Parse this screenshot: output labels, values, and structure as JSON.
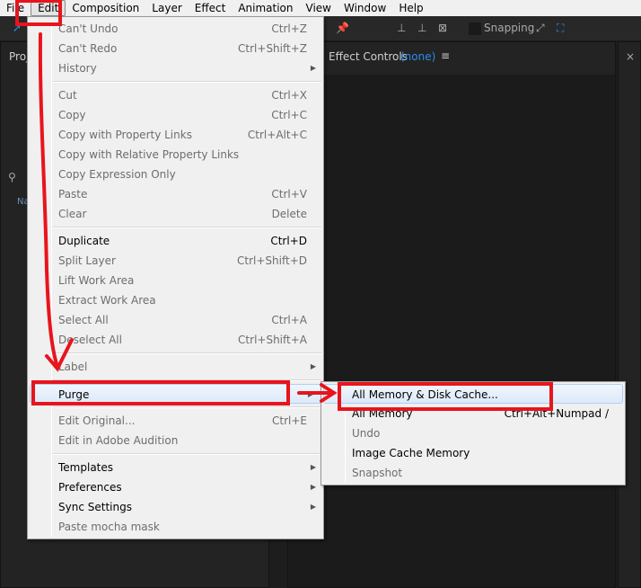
{
  "menubar": [
    "File",
    "Edit",
    "Composition",
    "Layer",
    "Effect",
    "Animation",
    "View",
    "Window",
    "Help"
  ],
  "toolbar": {
    "snapping": "Snapping"
  },
  "panels": {
    "project": "Proj",
    "effect_controls": "Effect Controls",
    "effect_controls_target": "(none)",
    "name_col": "Na",
    "close": "×"
  },
  "edit_menu": [
    {
      "label": "Can't Undo",
      "shortcut": "Ctrl+Z",
      "enabled": false
    },
    {
      "label": "Can't Redo",
      "shortcut": "Ctrl+Shift+Z",
      "enabled": false
    },
    {
      "label": "History",
      "shortcut": "",
      "enabled": false,
      "submenu": true
    },
    {
      "sep": true
    },
    {
      "label": "Cut",
      "shortcut": "Ctrl+X",
      "enabled": false
    },
    {
      "label": "Copy",
      "shortcut": "Ctrl+C",
      "enabled": false
    },
    {
      "label": "Copy with Property Links",
      "shortcut": "Ctrl+Alt+C",
      "enabled": false
    },
    {
      "label": "Copy with Relative Property Links",
      "shortcut": "",
      "enabled": false
    },
    {
      "label": "Copy Expression Only",
      "shortcut": "",
      "enabled": false
    },
    {
      "label": "Paste",
      "shortcut": "Ctrl+V",
      "enabled": false
    },
    {
      "label": "Clear",
      "shortcut": "Delete",
      "enabled": false
    },
    {
      "sep": true
    },
    {
      "label": "Duplicate",
      "shortcut": "Ctrl+D",
      "enabled": true
    },
    {
      "label": "Split Layer",
      "shortcut": "Ctrl+Shift+D",
      "enabled": false
    },
    {
      "label": "Lift Work Area",
      "shortcut": "",
      "enabled": false
    },
    {
      "label": "Extract Work Area",
      "shortcut": "",
      "enabled": false
    },
    {
      "label": "Select All",
      "shortcut": "Ctrl+A",
      "enabled": false
    },
    {
      "label": "Deselect All",
      "shortcut": "Ctrl+Shift+A",
      "enabled": false
    },
    {
      "sep": true
    },
    {
      "label": "Label",
      "shortcut": "",
      "enabled": false,
      "submenu": true
    },
    {
      "sep": true
    },
    {
      "label": "Purge",
      "shortcut": "",
      "enabled": true,
      "submenu": true,
      "highlighted": true
    },
    {
      "sep": true
    },
    {
      "label": "Edit Original...",
      "shortcut": "Ctrl+E",
      "enabled": false
    },
    {
      "label": "Edit in Adobe Audition",
      "shortcut": "",
      "enabled": false
    },
    {
      "sep": true
    },
    {
      "label": "Templates",
      "shortcut": "",
      "enabled": true,
      "submenu": true
    },
    {
      "label": "Preferences",
      "shortcut": "",
      "enabled": true,
      "submenu": true
    },
    {
      "label": "Sync Settings",
      "shortcut": "",
      "enabled": true,
      "submenu": true
    },
    {
      "label": "Paste mocha mask",
      "shortcut": "",
      "enabled": false
    }
  ],
  "purge_menu": [
    {
      "label": "All Memory & Disk Cache...",
      "shortcut": "",
      "enabled": true,
      "highlighted": true
    },
    {
      "label": "All Memory",
      "shortcut": "Ctrl+Alt+Numpad /",
      "enabled": true
    },
    {
      "label": "Undo",
      "shortcut": "",
      "enabled": false
    },
    {
      "label": "Image Cache Memory",
      "shortcut": "",
      "enabled": true
    },
    {
      "label": "Snapshot",
      "shortcut": "",
      "enabled": false
    }
  ],
  "colors": {
    "annotation": "#e8141c",
    "link": "#2d8ceb"
  }
}
